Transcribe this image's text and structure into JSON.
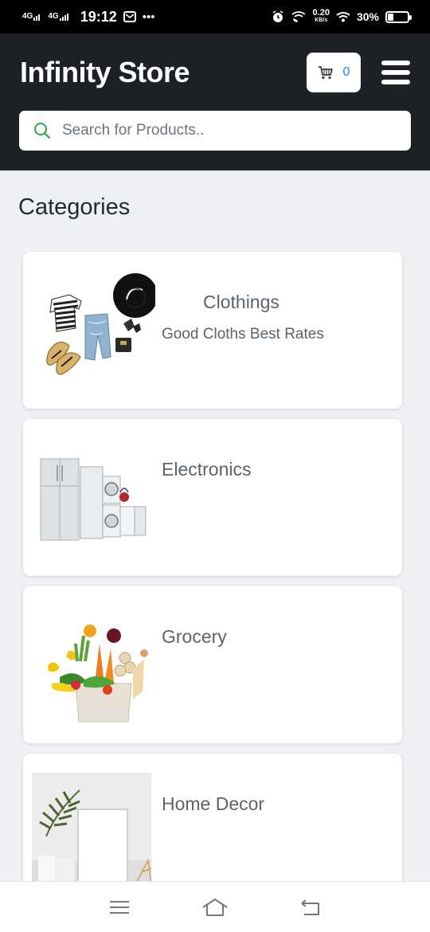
{
  "status_bar": {
    "network_1": "4G",
    "network_2": "4G",
    "time": "19:12",
    "speed_value": "0.20",
    "speed_unit": "KB/s",
    "battery_percent": "30%",
    "battery_level": 0.3
  },
  "header": {
    "title": "Infinity Store",
    "cart_count": "0",
    "search_placeholder": "Search for Products.."
  },
  "main": {
    "section_title": "Categories",
    "categories": [
      {
        "name": "Clothings",
        "description": "Good Cloths Best Rates"
      },
      {
        "name": "Electronics",
        "description": ""
      },
      {
        "name": "Grocery",
        "description": ""
      },
      {
        "name": "Home Decor",
        "description": ""
      }
    ]
  },
  "colors": {
    "header_bg": "#1d2125",
    "page_bg": "#eef0f4",
    "cart_count": "#1f8bd6",
    "search_icon": "#28a745"
  }
}
